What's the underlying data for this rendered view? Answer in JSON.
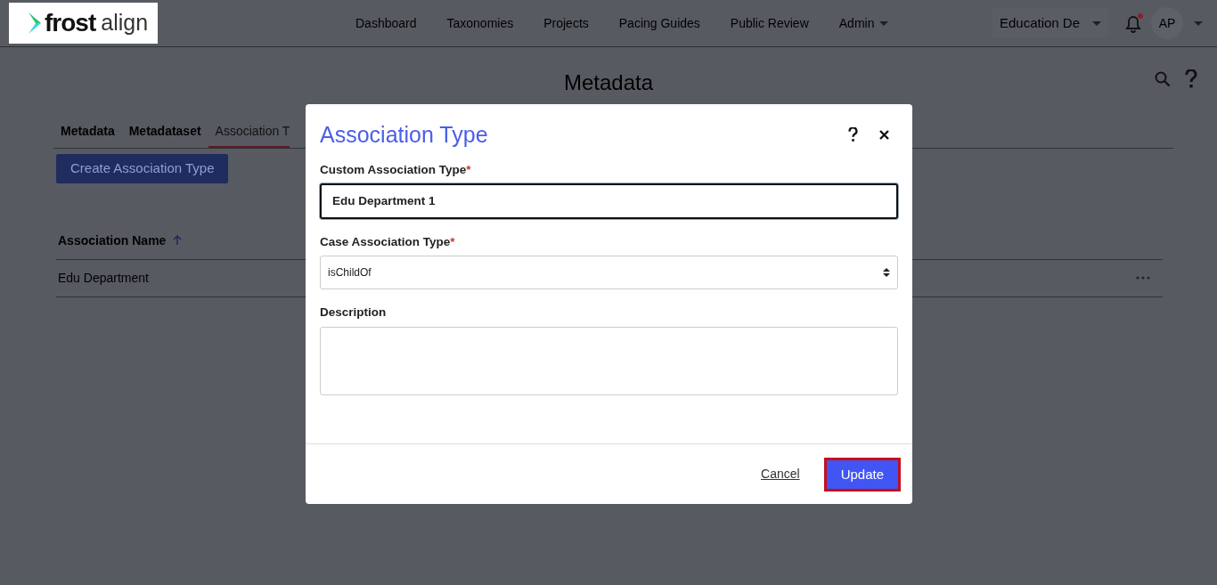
{
  "logo": {
    "bold": "frost",
    "light": "align"
  },
  "nav": [
    {
      "label": "Dashboard",
      "dropdown": false
    },
    {
      "label": "Taxonomies",
      "dropdown": false
    },
    {
      "label": "Projects",
      "dropdown": false
    },
    {
      "label": "Pacing Guides",
      "dropdown": false
    },
    {
      "label": "Public Review",
      "dropdown": false
    },
    {
      "label": "Admin",
      "dropdown": true
    }
  ],
  "org_selector": {
    "label": "Education De"
  },
  "notifications": {
    "unread": true
  },
  "user": {
    "initials": "AP"
  },
  "page": {
    "title": "Metadata"
  },
  "tabs": [
    {
      "label": "Metadata",
      "selected": false
    },
    {
      "label": "Metadataset",
      "selected": false
    },
    {
      "label": "Association T",
      "selected": true
    }
  ],
  "create_button": {
    "label": "Create Association Type"
  },
  "table": {
    "columns": [
      {
        "label": "Association Name",
        "sorted_ascending": true
      }
    ],
    "rows": [
      {
        "name": "Edu Department"
      }
    ]
  },
  "modal": {
    "title": "Association Type",
    "fields": [
      {
        "kind": "text",
        "label": "Custom Association Type",
        "required_mark": "*",
        "value": "Edu Department 1",
        "focused": true
      },
      {
        "kind": "select",
        "label": "Case Association Type",
        "required_mark": "*",
        "value": "isChildOf",
        "focused": false
      },
      {
        "kind": "textarea",
        "label": "Description",
        "focused": false
      }
    ],
    "cancel": {
      "label": "Cancel"
    },
    "submit": {
      "label": "Update",
      "highlighted": true
    }
  }
}
